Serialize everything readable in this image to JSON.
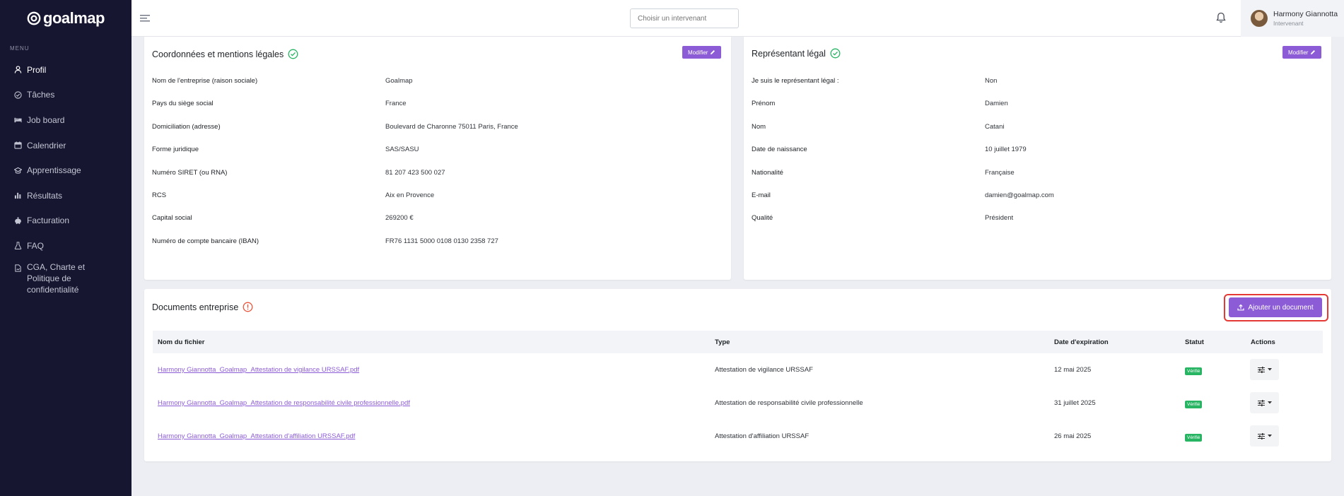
{
  "app": {
    "logo_text": "goalmap"
  },
  "sidebar": {
    "menu_label": "MENU",
    "items": [
      {
        "label": "Profil",
        "icon": "user-icon",
        "active": true
      },
      {
        "label": "Tâches",
        "icon": "check-circle-icon"
      },
      {
        "label": "Job board",
        "icon": "bed-icon"
      },
      {
        "label": "Calendrier",
        "icon": "calendar-icon"
      },
      {
        "label": "Apprentissage",
        "icon": "graduation-icon"
      },
      {
        "label": "Résultats",
        "icon": "bar-chart-icon"
      },
      {
        "label": "Facturation",
        "icon": "piggy-bank-icon"
      },
      {
        "label": "FAQ",
        "icon": "flask-icon"
      },
      {
        "label": "CGA, Charte et Politique de confidentialité",
        "icon": "file-signature-icon"
      }
    ]
  },
  "topbar": {
    "search_placeholder": "Choisir un intervenant",
    "user_name": "Harmony Giannotta",
    "user_role": "Intervenant"
  },
  "company": {
    "title": "Coordonnées et mentions légales",
    "edit_label": "Modifier",
    "rows": [
      {
        "label": "Nom de l'entreprise (raison sociale)",
        "value": "Goalmap"
      },
      {
        "label": "Pays du siège social",
        "value": "France"
      },
      {
        "label": "Domiciliation (adresse)",
        "value": "Boulevard de Charonne 75011 Paris, France"
      },
      {
        "label": "Forme juridique",
        "value": "SAS/SASU"
      },
      {
        "label": "Numéro SIRET (ou RNA)",
        "value": "81 207 423 500 027"
      },
      {
        "label": "RCS",
        "value": "Aix en Provence"
      },
      {
        "label": "Capital social",
        "value": "269200 €"
      },
      {
        "label": "Numéro de compte bancaire (IBAN)",
        "value": "FR76 1131 5000 0108 0130 2358 727"
      }
    ]
  },
  "legal": {
    "title": "Représentant légal",
    "edit_label": "Modifier",
    "rows": [
      {
        "label": "Je suis le représentant légal :",
        "value": "Non"
      },
      {
        "label": "Prénom",
        "value": "Damien"
      },
      {
        "label": "Nom",
        "value": "Catani"
      },
      {
        "label": "Date de naissance",
        "value": "10 juillet 1979"
      },
      {
        "label": "Nationalité",
        "value": "Française"
      },
      {
        "label": "E-mail",
        "value": "damien@goalmap.com"
      },
      {
        "label": "Qualité",
        "value": "Président"
      }
    ]
  },
  "documents": {
    "title": "Documents entreprise",
    "add_label": "Ajouter un document",
    "columns": [
      "Nom du fichier",
      "Type",
      "Date d'expiration",
      "Statut",
      "Actions"
    ],
    "rows": [
      {
        "file": "Harmony Giannotta_Goalmap_Attestation de vigilance URSSAF.pdf",
        "type": "Attestation de vigilance URSSAF",
        "expiry": "12 mai 2025",
        "status": "Vérifié"
      },
      {
        "file": "Harmony Giannotta_Goalmap_Attestation de responsabilité civile professionnelle.pdf",
        "type": "Attestation de responsabilité civile professionnelle",
        "expiry": "31 juillet 2025",
        "status": "Vérifié"
      },
      {
        "file": "Harmony Giannotta_Goalmap_Attestation d'affiliation URSSAF.pdf",
        "type": "Attestation d'affiliation URSSAF",
        "expiry": "26 mai 2025",
        "status": "Vérifié"
      }
    ]
  },
  "colors": {
    "accent": "#8c5cd7",
    "sidebar": "#161631",
    "success": "#27b463",
    "warning": "#e8553c"
  }
}
